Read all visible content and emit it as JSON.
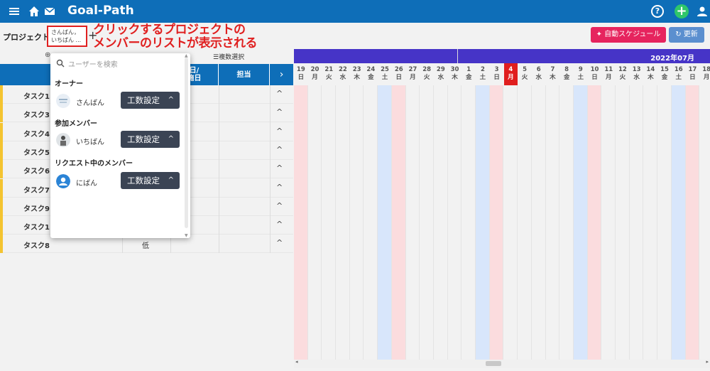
{
  "header": {
    "app_title": "Goal-Path",
    "icons": [
      "menu-icon",
      "home-icon",
      "mail-icon",
      "help-icon",
      "add-icon",
      "user-icon"
    ],
    "help_glyph": "?",
    "add_glyph": "+"
  },
  "project": {
    "name": "プロジェクト3",
    "member_line1": "さんばん，",
    "member_line2": "いちばん ...",
    "add_glyph": "+"
  },
  "annotation": {
    "line1": "クリックするプロジェクトの",
    "line2": "メンバーのリストが表示される",
    "color": "#e02020"
  },
  "toolbar": {
    "auto_schedule_label": "自動スケジュール",
    "refresh_label": "更新",
    "multi_select_label": "複数選択"
  },
  "table": {
    "headers": [
      {
        "label": "タ\nス"
      },
      {
        "label": "日/\n施日"
      },
      {
        "label": "担当"
      }
    ],
    "arrow_glyph": "›",
    "rows": [
      {
        "name": "タスク1",
        "priority": ""
      },
      {
        "name": "タスク3",
        "priority": ""
      },
      {
        "name": "タスク4",
        "priority": ""
      },
      {
        "name": "タスク5",
        "priority": ""
      },
      {
        "name": "タスク6",
        "priority": ""
      },
      {
        "name": "タスク7",
        "priority": ""
      },
      {
        "name": "タスク9",
        "priority": ""
      },
      {
        "name": "タスク1",
        "priority": ""
      },
      {
        "name": "タスク8",
        "priority": "低"
      }
    ],
    "chevron_glyph": "^"
  },
  "gantt": {
    "month_label": "2022年07月",
    "days": [
      {
        "d": "19",
        "w": "日"
      },
      {
        "d": "20",
        "w": "月"
      },
      {
        "d": "21",
        "w": "火"
      },
      {
        "d": "22",
        "w": "水"
      },
      {
        "d": "23",
        "w": "木"
      },
      {
        "d": "24",
        "w": "金"
      },
      {
        "d": "25",
        "w": "土"
      },
      {
        "d": "26",
        "w": "日"
      },
      {
        "d": "27",
        "w": "月"
      },
      {
        "d": "28",
        "w": "火"
      },
      {
        "d": "29",
        "w": "水"
      },
      {
        "d": "30",
        "w": "木"
      },
      {
        "d": "1",
        "w": "金"
      },
      {
        "d": "2",
        "w": "土"
      },
      {
        "d": "3",
        "w": "日"
      },
      {
        "d": "4",
        "w": "月"
      },
      {
        "d": "5",
        "w": "火"
      },
      {
        "d": "6",
        "w": "水"
      },
      {
        "d": "7",
        "w": "木"
      },
      {
        "d": "8",
        "w": "金"
      },
      {
        "d": "9",
        "w": "土"
      },
      {
        "d": "10",
        "w": "日"
      },
      {
        "d": "11",
        "w": "月"
      },
      {
        "d": "12",
        "w": "火"
      },
      {
        "d": "13",
        "w": "水"
      },
      {
        "d": "14",
        "w": "木"
      },
      {
        "d": "15",
        "w": "金"
      },
      {
        "d": "16",
        "w": "土"
      },
      {
        "d": "17",
        "w": "日"
      },
      {
        "d": "18",
        "w": "月"
      }
    ],
    "today": "4",
    "colors": {
      "saturday": "#d8e6fb",
      "sunday": "#fbdcde",
      "today": "#e01e1e",
      "month_bar": "#4634c7"
    }
  },
  "member_dropdown": {
    "search_placeholder": "ユーザーを検索",
    "sections": {
      "owner": "オーナー",
      "members": "参加メンバー",
      "requests": "リクエスト中のメンバー"
    },
    "owner": {
      "name": "さんばん",
      "button": "工数設定"
    },
    "members": [
      {
        "name": "いちばん",
        "button": "工数設定"
      }
    ],
    "requests": [
      {
        "name": "にばん",
        "button": "工数設定"
      }
    ],
    "caret_glyph": "^"
  }
}
